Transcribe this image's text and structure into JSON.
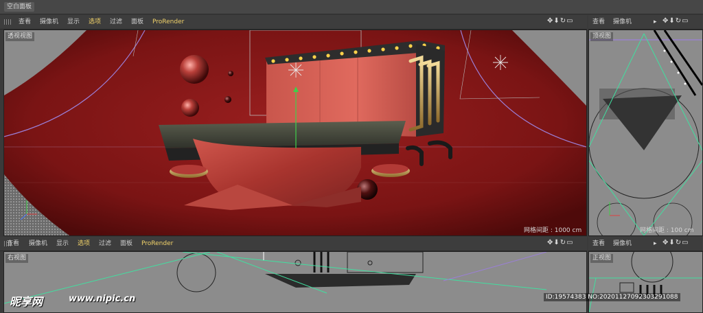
{
  "window": {
    "title_tab": "空白面板"
  },
  "viewport_main": {
    "menu": [
      "查看",
      "摄像机",
      "显示",
      "选项",
      "过滤",
      "面板",
      "ProRender"
    ],
    "highlighted": "选项",
    "label": "透视视图",
    "grid_info": "网格间距 : 1000 cm",
    "nav_icons": "✥⬇↻▭"
  },
  "viewport_top": {
    "menu": [
      "查看",
      "摄像机"
    ],
    "label": "顶视图",
    "grid_info": "网格间距 : 100 cm",
    "nav_icons": "✥⬇↻▭"
  },
  "viewport_right": {
    "menu": [
      "查看",
      "摄像机",
      "显示",
      "选项",
      "过滤",
      "面板",
      "ProRender"
    ],
    "highlighted": "选项",
    "label": "右视图",
    "nav_icons": "✥⬇↻▭"
  },
  "viewport_front": {
    "menu": [
      "查看",
      "摄像机"
    ],
    "label": "正视图",
    "nav_icons": "✥⬇↻▭"
  },
  "watermark": {
    "logo": "昵享网",
    "url": "www.nipic.cn",
    "id": "ID:19574383 NO:20201127092303291088"
  },
  "colors": {
    "accent": "#f2d36a",
    "stage_red": "#8a1a1a",
    "panel": "#3d3d3d"
  }
}
